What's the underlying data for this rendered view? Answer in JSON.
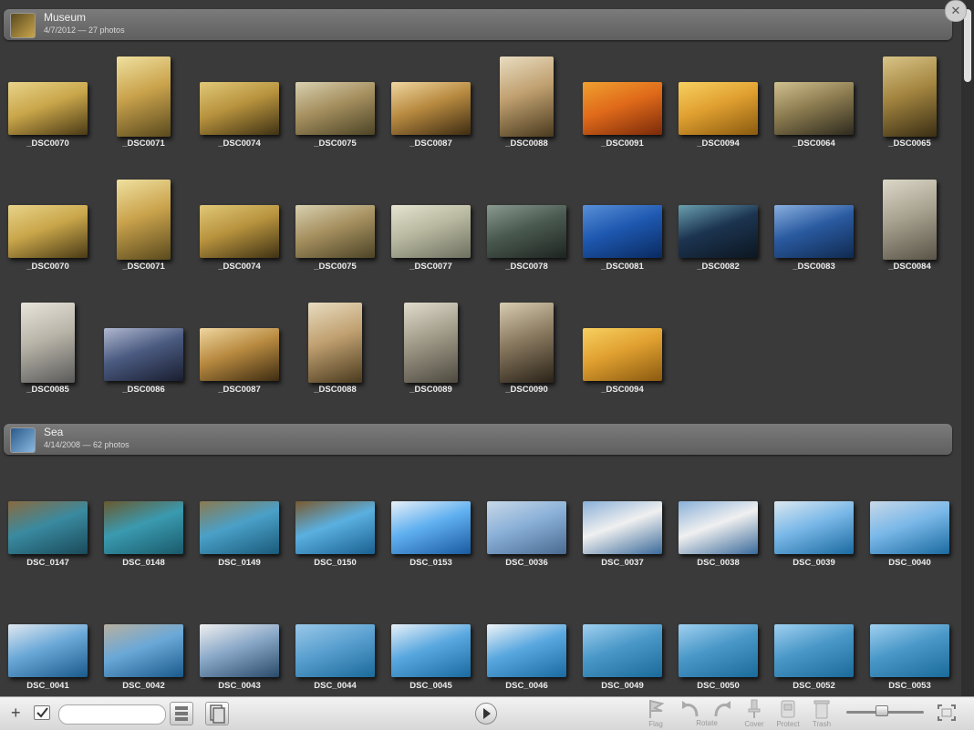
{
  "events": [
    {
      "title": "Museum",
      "subtitle": "4/7/2012 — 27 photos",
      "rows": [
        [
          {
            "name": "_DSC0070",
            "orient": "landscape",
            "colors": [
              "#4a3a16",
              "#c9a64a",
              "#e8d38a"
            ]
          },
          {
            "name": "_DSC0071",
            "orient": "portrait",
            "colors": [
              "#5a4a1e",
              "#caa34c",
              "#efe0a0"
            ]
          },
          {
            "name": "_DSC0074",
            "orient": "landscape",
            "colors": [
              "#3f3214",
              "#b8933e",
              "#e0c878"
            ]
          },
          {
            "name": "_DSC0075",
            "orient": "landscape",
            "colors": [
              "#4c4426",
              "#a69060",
              "#d8d0b0"
            ]
          },
          {
            "name": "_DSC0087",
            "orient": "landscape",
            "colors": [
              "#3e2c12",
              "#b88a40",
              "#efd6a0"
            ]
          },
          {
            "name": "_DSC0088",
            "orient": "portrait",
            "colors": [
              "#4a3a1e",
              "#c0a070",
              "#e8dcc0"
            ]
          },
          {
            "name": "_DSC0091",
            "orient": "landscape",
            "colors": [
              "#7a2a0a",
              "#e06a1a",
              "#f0a030"
            ]
          },
          {
            "name": "_DSC0094",
            "orient": "landscape",
            "colors": [
              "#8a5a10",
              "#e0a030",
              "#f7d060"
            ]
          },
          {
            "name": "_DSC0064",
            "orient": "landscape",
            "colors": [
              "#2e2a1e",
              "#8c7c50",
              "#d0c090"
            ]
          },
          {
            "name": "_DSC0065",
            "orient": "portrait",
            "colors": [
              "#3a2e14",
              "#a48640",
              "#d8c488"
            ]
          }
        ],
        [
          {
            "name": "_DSC0070",
            "orient": "landscape",
            "colors": [
              "#4a3a16",
              "#c9a64a",
              "#e8d38a"
            ]
          },
          {
            "name": "_DSC0071",
            "orient": "portrait",
            "colors": [
              "#5a4a1e",
              "#caa34c",
              "#efe0a0"
            ]
          },
          {
            "name": "_DSC0074",
            "orient": "landscape",
            "colors": [
              "#3f3214",
              "#b8933e",
              "#e0c878"
            ]
          },
          {
            "name": "_DSC0075",
            "orient": "landscape",
            "colors": [
              "#4c4426",
              "#a69060",
              "#d8d0b0"
            ]
          },
          {
            "name": "_DSC0077",
            "orient": "landscape",
            "colors": [
              "#6e7060",
              "#b8b8a0",
              "#e4e4d0"
            ]
          },
          {
            "name": "_DSC0078",
            "orient": "landscape",
            "colors": [
              "#1e2420",
              "#4a5a50",
              "#8a9a90"
            ]
          },
          {
            "name": "_DSC0081",
            "orient": "landscape",
            "colors": [
              "#0a2a60",
              "#1e58b0",
              "#5a90d8"
            ]
          },
          {
            "name": "_DSC0082",
            "orient": "landscape",
            "colors": [
              "#0c1620",
              "#1c3450",
              "#6aa0b0"
            ]
          },
          {
            "name": "_DSC0083",
            "orient": "landscape",
            "colors": [
              "#102a50",
              "#2a5aa0",
              "#8ab0e0"
            ]
          },
          {
            "name": "_DSC0084",
            "orient": "portrait",
            "colors": [
              "#5a5448",
              "#a8a290",
              "#dcd8c8"
            ]
          }
        ],
        [
          {
            "name": "_DSC0085",
            "orient": "portrait",
            "colors": [
              "#5a5a5a",
              "#b8b4a8",
              "#e8e4da"
            ]
          },
          {
            "name": "_DSC0086",
            "orient": "landscape",
            "colors": [
              "#1a1e30",
              "#4a5a80",
              "#b0b8d0"
            ]
          },
          {
            "name": "_DSC0087",
            "orient": "landscape",
            "colors": [
              "#3e2c12",
              "#b88a40",
              "#efd6a0"
            ]
          },
          {
            "name": "_DSC0088",
            "orient": "portrait",
            "colors": [
              "#4a3a1e",
              "#c0a070",
              "#e8dcc0"
            ]
          },
          {
            "name": "_DSC0089",
            "orient": "portrait",
            "colors": [
              "#4e4a40",
              "#a09a88",
              "#e0dccc"
            ]
          },
          {
            "name": "_DSC0090",
            "orient": "portrait",
            "colors": [
              "#2a2218",
              "#8a7a60",
              "#d8ccb0"
            ]
          },
          {
            "name": "_DSC0094",
            "orient": "landscape",
            "colors": [
              "#8a5a10",
              "#e0a030",
              "#f7d060"
            ]
          }
        ]
      ]
    },
    {
      "title": "Sea",
      "subtitle": "4/14/2008 — 62 photos",
      "rows": [
        [
          {
            "name": "DSC_0147",
            "orient": "landscape",
            "colors": [
              "#1a4a5a",
              "#3a8aa0",
              "#8a6a40"
            ]
          },
          {
            "name": "DSC_0148",
            "orient": "landscape",
            "colors": [
              "#1a5a6a",
              "#3a9ab0",
              "#6a5a30"
            ]
          },
          {
            "name": "DSC_0149",
            "orient": "landscape",
            "colors": [
              "#1a5a7a",
              "#4aa0c8",
              "#8a7a50"
            ]
          },
          {
            "name": "DSC_0150",
            "orient": "landscape",
            "colors": [
              "#1a6090",
              "#5ab0e0",
              "#7a5a30"
            ]
          },
          {
            "name": "DSC_0153",
            "orient": "landscape",
            "colors": [
              "#1a5aa0",
              "#60b0f0",
              "#e8f0f8"
            ]
          },
          {
            "name": "DSC_0036",
            "orient": "landscape",
            "colors": [
              "#4a6a90",
              "#8ab0d8",
              "#c8d8e8"
            ]
          },
          {
            "name": "DSC_0037",
            "orient": "landscape",
            "colors": [
              "#3a6a9a",
              "#f0f0f0",
              "#8ab0d8"
            ]
          },
          {
            "name": "DSC_0038",
            "orient": "landscape",
            "colors": [
              "#3a6a9a",
              "#f0f0f0",
              "#8ab0d8"
            ]
          },
          {
            "name": "DSC_0039",
            "orient": "landscape",
            "colors": [
              "#1a6aa0",
              "#7ab8e8",
              "#dce8f0"
            ]
          },
          {
            "name": "DSC_0040",
            "orient": "landscape",
            "colors": [
              "#1a6aa0",
              "#7ab8e8",
              "#c8d8e8"
            ]
          }
        ],
        [
          {
            "name": "DSC_0041",
            "orient": "landscape",
            "colors": [
              "#1a5a8a",
              "#6aa8d8",
              "#e0e8f0"
            ]
          },
          {
            "name": "DSC_0042",
            "orient": "landscape",
            "colors": [
              "#1a5a8a",
              "#6aa8d8",
              "#b8b0a0"
            ]
          },
          {
            "name": "DSC_0043",
            "orient": "landscape",
            "colors": [
              "#2a4a6a",
              "#8aa8c8",
              "#f0f0f0"
            ]
          },
          {
            "name": "DSC_0044",
            "orient": "landscape",
            "colors": [
              "#1a6a9a",
              "#5aa0d0",
              "#9ac8e8"
            ]
          },
          {
            "name": "DSC_0045",
            "orient": "landscape",
            "colors": [
              "#1a6aa0",
              "#5aa8e0",
              "#e8f0f8"
            ]
          },
          {
            "name": "DSC_0046",
            "orient": "landscape",
            "colors": [
              "#1a6aa0",
              "#5aa8e0",
              "#f0f4f8"
            ]
          },
          {
            "name": "DSC_0049",
            "orient": "landscape",
            "colors": [
              "#1a6a9a",
              "#4a98c8",
              "#a0d0f0"
            ]
          },
          {
            "name": "DSC_0050",
            "orient": "landscape",
            "colors": [
              "#1a6a9a",
              "#4a98c8",
              "#a0d0f0"
            ]
          },
          {
            "name": "DSC_0052",
            "orient": "landscape",
            "colors": [
              "#1a6a9a",
              "#4a98c8",
              "#a0d0f0"
            ]
          },
          {
            "name": "DSC_0053",
            "orient": "landscape",
            "colors": [
              "#1a6a9a",
              "#4a98c8",
              "#a0d0f0"
            ]
          }
        ]
      ]
    }
  ],
  "toolbar": {
    "add_icon": "plus-icon",
    "search_placeholder": "",
    "flag_label": "Flag",
    "rotate_label": "Rotate",
    "cover_label": "Cover",
    "protect_label": "Protect",
    "trash_label": "Trash"
  }
}
